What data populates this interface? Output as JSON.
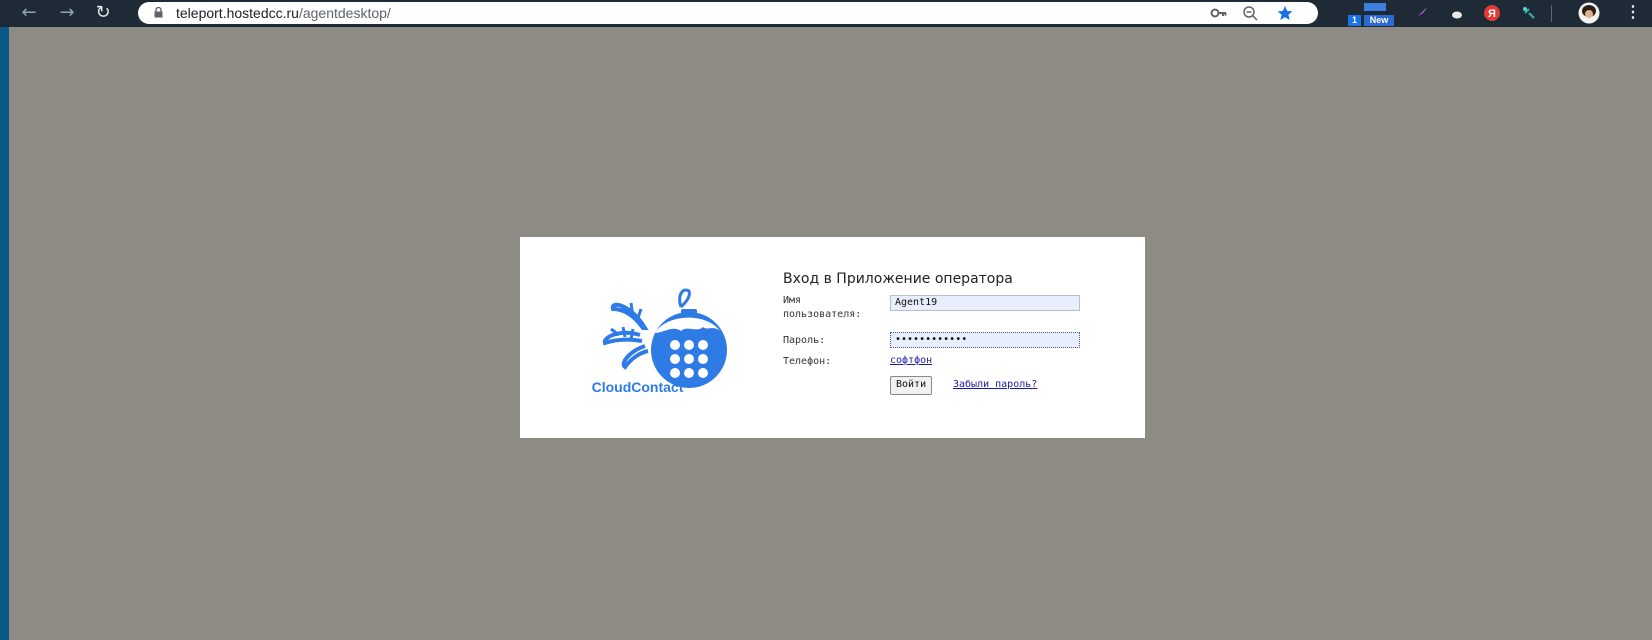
{
  "browser": {
    "url_host": "teleport.hostedcc.ru",
    "url_path": "/agentdesktop/",
    "extensions": {
      "badge_count": "1",
      "badge_new": "New"
    }
  },
  "login": {
    "title": "Вход в Приложение оператора",
    "username_label_line1": "Имя",
    "username_label_line2": "пользователя:",
    "username_value": "Agent19",
    "password_label": "Пароль:",
    "password_value": "••••••••••••",
    "phone_label": "Телефон:",
    "phone_link": "софтфон",
    "submit_label": "Войти",
    "forgot_link": "Забыли пароль?"
  },
  "logo": {
    "brand": "CloudContact",
    "icon": "ornament-dialpad-icon"
  },
  "colors": {
    "brand_blue": "#2e7be6",
    "page_bg": "#8e8b85",
    "chrome_bg": "#1e2a36"
  }
}
